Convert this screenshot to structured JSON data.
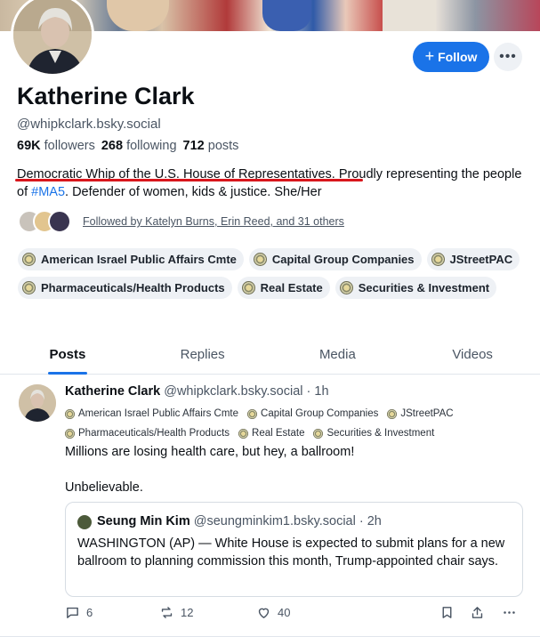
{
  "profile": {
    "name": "Katherine Clark",
    "handle": "@whipkclark.bsky.social",
    "followers_count": "69K",
    "followers_label": "followers",
    "following_count": "268",
    "following_label": "following",
    "posts_count": "712",
    "posts_label": "posts",
    "bio_highlight": "Democratic Whip of the U.S. House of Representatives",
    "bio_part1": ". Proudly representing the people of ",
    "bio_tag": "#MA5",
    "bio_part2": ". Defender of women, kids & justice. She/Her",
    "followed_by": "Followed by Katelyn Burns, Erin Reed, and 31 others",
    "follow_button": "Follow",
    "more_button": "•••"
  },
  "chips": [
    "American Israel Public Affairs Cmte",
    "Capital Group Companies",
    "JStreetPAC",
    "Pharmaceuticals/Health Products",
    "Real Estate",
    "Securities & Investment"
  ],
  "tabs": [
    "Posts",
    "Replies",
    "Media",
    "Videos"
  ],
  "post": {
    "author": "Katherine Clark",
    "handle": "@whipkclark.bsky.social",
    "time": "· 1h",
    "chips": [
      "American Israel Public Affairs Cmte",
      "Capital Group Companies",
      "JStreetPAC",
      "Pharmaceuticals/Health Products",
      "Real Estate",
      "Securities & Investment"
    ],
    "text_line1": "Millions are losing health care, but hey, a ballroom!",
    "text_line2": "Unbelievable.",
    "quote": {
      "author": "Seung Min Kim",
      "handle": "@seungminkim1.bsky.social",
      "time": "· 2h",
      "text": "WASHINGTON (AP) — White House is expected to submit plans for a new ballroom to planning commission this month, Trump-appointed chair says."
    },
    "replies": "6",
    "reposts": "12",
    "likes": "40"
  },
  "colors": {
    "accent": "#1a73e8",
    "highlight_underline": "#d8161c"
  }
}
